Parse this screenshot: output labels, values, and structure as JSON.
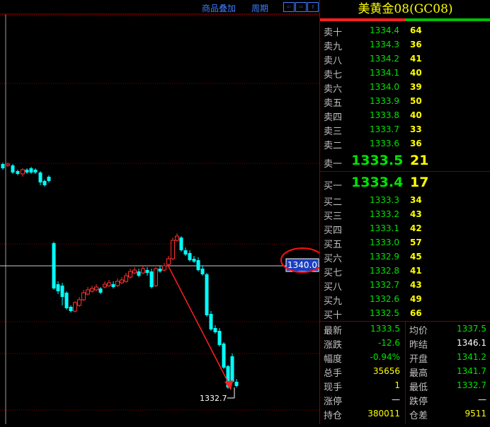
{
  "toolbar": {
    "overlay_label": "商品叠加",
    "period_label": "周期",
    "btn_left": "⇦",
    "btn_right": "⇨",
    "btn_toggle": "⇧"
  },
  "chart": {
    "price_tag": "1340.0",
    "low_label": "1332.7"
  },
  "chart_data": {
    "type": "candlestick",
    "crosshair_price": 1340.0,
    "marked_low": 1332.7
  },
  "quote": {
    "title": "美黄金08(GC08)",
    "asks": [
      {
        "label": "卖十",
        "price": "1334.4",
        "vol": "64"
      },
      {
        "label": "卖九",
        "price": "1334.3",
        "vol": "36"
      },
      {
        "label": "卖八",
        "price": "1334.2",
        "vol": "41"
      },
      {
        "label": "卖七",
        "price": "1334.1",
        "vol": "40"
      },
      {
        "label": "卖六",
        "price": "1334.0",
        "vol": "39"
      },
      {
        "label": "卖五",
        "price": "1333.9",
        "vol": "50"
      },
      {
        "label": "卖四",
        "price": "1333.8",
        "vol": "40"
      },
      {
        "label": "卖三",
        "price": "1333.7",
        "vol": "33"
      },
      {
        "label": "卖二",
        "price": "1333.6",
        "vol": "36"
      },
      {
        "label": "卖一",
        "price": "1333.5",
        "vol": "21"
      }
    ],
    "bids": [
      {
        "label": "买一",
        "price": "1333.4",
        "vol": "17"
      },
      {
        "label": "买二",
        "price": "1333.3",
        "vol": "34"
      },
      {
        "label": "买三",
        "price": "1333.2",
        "vol": "43"
      },
      {
        "label": "买四",
        "price": "1333.1",
        "vol": "42"
      },
      {
        "label": "买五",
        "price": "1333.0",
        "vol": "57"
      },
      {
        "label": "买六",
        "price": "1332.9",
        "vol": "45"
      },
      {
        "label": "买七",
        "price": "1332.8",
        "vol": "41"
      },
      {
        "label": "买八",
        "price": "1332.7",
        "vol": "43"
      },
      {
        "label": "买九",
        "price": "1332.6",
        "vol": "49"
      },
      {
        "label": "买十",
        "price": "1332.5",
        "vol": "66"
      }
    ],
    "stats": [
      {
        "l1": "最新",
        "v1": "1333.5",
        "c1": "green",
        "l2": "均价",
        "v2": "1337.5",
        "c2": "green"
      },
      {
        "l1": "涨跌",
        "v1": "-12.6",
        "c1": "green",
        "l2": "昨结",
        "v2": "1346.1",
        "c2": "white"
      },
      {
        "l1": "幅度",
        "v1": "-0.94%",
        "c1": "green",
        "l2": "开盘",
        "v2": "1341.2",
        "c2": "green"
      },
      {
        "l1": "总手",
        "v1": "35656",
        "c1": "yellow",
        "l2": "最高",
        "v2": "1341.7",
        "c2": "green"
      },
      {
        "l1": "现手",
        "v1": "1",
        "c1": "yellow",
        "l2": "最低",
        "v2": "1332.7",
        "c2": "green"
      },
      {
        "l1": "涨停",
        "v1": "—",
        "c1": "white",
        "l2": "跌停",
        "v2": "—",
        "c2": "white"
      },
      {
        "l1": "持仓",
        "v1": "380011",
        "c1": "yellow",
        "l2": "仓差",
        "v2": "9511",
        "c2": "yellow"
      }
    ]
  },
  "colors": {
    "up": "#ff3030",
    "down": "#00ffff",
    "grid": "#7a0000",
    "accent_blue": "#3f7fff",
    "price_green": "#00e400",
    "volume_yellow": "#ffff00"
  }
}
